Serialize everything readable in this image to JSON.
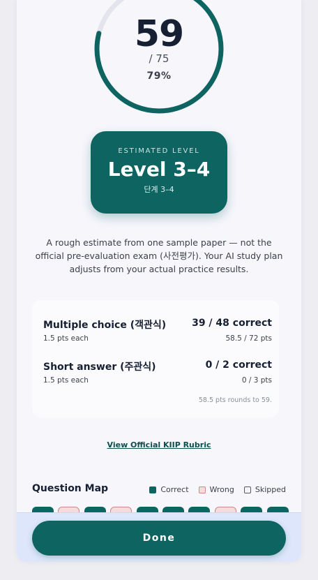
{
  "score": {
    "value": "59",
    "total": "/ 75",
    "percent": "79%",
    "progress": 0.79,
    "ring_color": "#0d6461",
    "track_color": "#e4e4ec"
  },
  "estimate": {
    "label": "ESTIMATED LEVEL",
    "value": "Level 3–4",
    "korean": "단계 3–4"
  },
  "disclaimer": "A rough estimate from one sample paper — not the official pre-evaluation exam (사전평가). Your AI study plan adjusts from your actual practice results.",
  "breakdown": {
    "rows": [
      {
        "title": "Multiple choice (객관식)",
        "sub": "1.5 pts each",
        "result": "39 / 48 correct",
        "points": "58.5 / 72 pts"
      },
      {
        "title": "Short answer (주관식)",
        "sub": "1.5 pts each",
        "result": "0 / 2 correct",
        "points": "0 / 3 pts"
      }
    ],
    "note": "58.5 pts rounds to 59."
  },
  "rubric_link": "View Official KIIP Rubric",
  "question_map": {
    "title": "Question Map",
    "legend": {
      "correct": "Correct",
      "wrong": "Wrong",
      "skipped": "Skipped"
    },
    "visible_cells": [
      "correct",
      "wrong",
      "correct",
      "wrong",
      "correct",
      "correct",
      "correct",
      "wrong",
      "correct",
      "correct"
    ]
  },
  "footer": {
    "done_label": "Done"
  },
  "colors": {
    "accent": "#0d6461",
    "wrong_fill": "#f5dcdc",
    "footer_bg": "#dde6fa"
  }
}
